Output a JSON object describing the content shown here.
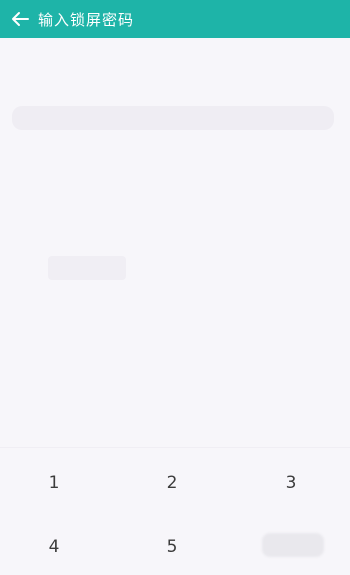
{
  "header": {
    "title": "输入锁屏密码",
    "back_icon": "arrow-left-icon",
    "color": "#1eb4a8"
  },
  "keypad": {
    "keys": [
      "1",
      "2",
      "3",
      "4",
      "5"
    ]
  }
}
